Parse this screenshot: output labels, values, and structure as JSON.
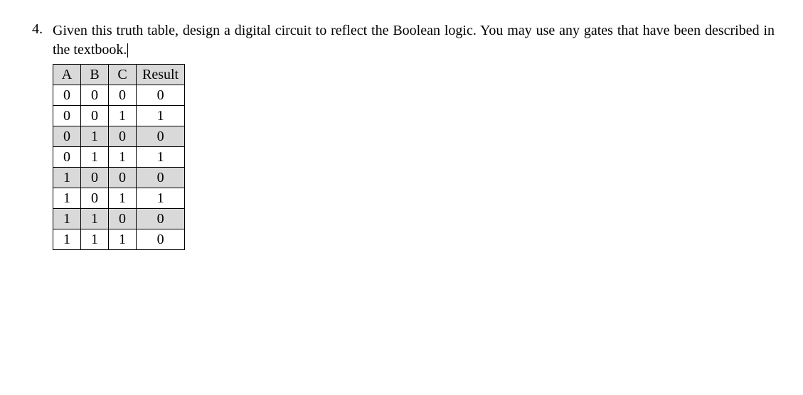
{
  "question": {
    "number": "4.",
    "text": "Given this truth table, design a digital circuit to reflect the Boolean logic. You may use any gates that have been described in the textbook."
  },
  "table": {
    "headers": [
      "A",
      "B",
      "C",
      "Result"
    ],
    "rows": [
      {
        "values": [
          "0",
          "0",
          "0",
          "0"
        ],
        "shaded": false
      },
      {
        "values": [
          "0",
          "0",
          "1",
          "1"
        ],
        "shaded": false
      },
      {
        "values": [
          "0",
          "1",
          "0",
          "0"
        ],
        "shaded": true
      },
      {
        "values": [
          "0",
          "1",
          "1",
          "1"
        ],
        "shaded": false
      },
      {
        "values": [
          "1",
          "0",
          "0",
          "0"
        ],
        "shaded": true
      },
      {
        "values": [
          "1",
          "0",
          "1",
          "1"
        ],
        "shaded": false
      },
      {
        "values": [
          "1",
          "1",
          "0",
          "0"
        ],
        "shaded": true
      },
      {
        "values": [
          "1",
          "1",
          "1",
          "0"
        ],
        "shaded": false
      }
    ]
  }
}
